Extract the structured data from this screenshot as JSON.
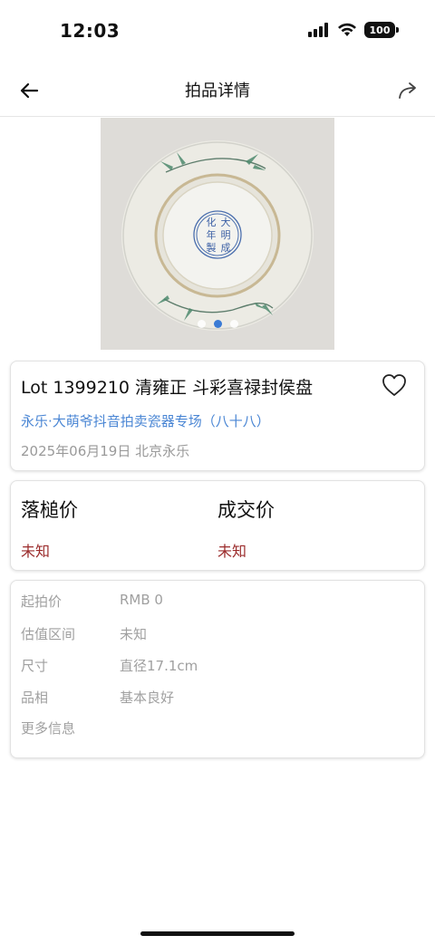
{
  "status_bar": {
    "time": "12:03",
    "battery": "100"
  },
  "nav": {
    "title": "拍品详情"
  },
  "carousel": {
    "mark": [
      "大",
      "明",
      "成",
      "化",
      "年",
      "製"
    ],
    "active_index": 1,
    "total": 3
  },
  "lot": {
    "title": "Lot 1399210 清雍正 斗彩喜禄封侯盘",
    "session": "永乐·大萌爷抖音拍卖瓷器专场（八十八）",
    "date_location": "2025年06月19日 北京永乐"
  },
  "prices": {
    "hammer_label": "落槌价",
    "hammer_value": "未知",
    "deal_label": "成交价",
    "deal_value": "未知"
  },
  "info": {
    "start_label": "起拍价",
    "start_value": "RMB 0",
    "estimate_label": "估值区间",
    "estimate_value": "未知",
    "size_label": "尺寸",
    "size_value": "直径17.1cm",
    "condition_label": "品相",
    "condition_value": "基本良好",
    "more_label": "更多信息"
  },
  "colors": {
    "link": "#4a86d4",
    "price": "#9b2b2b",
    "dot_active": "#3a7bd5"
  }
}
